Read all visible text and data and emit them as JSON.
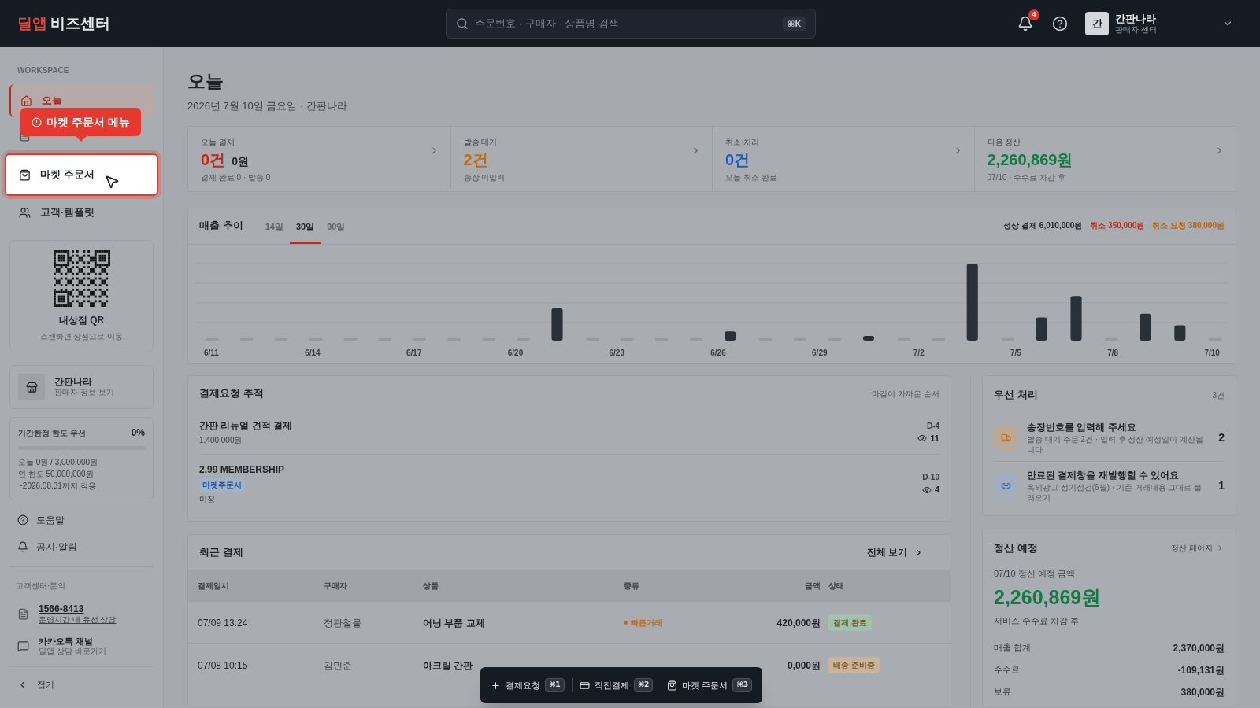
{
  "brand": {
    "accent": "딜앱",
    "name": "비즈센터"
  },
  "search": {
    "placeholder": "주문번호 · 구매자 · 상품명 검색",
    "shortcut": "⌘K"
  },
  "notifications": {
    "count": "4"
  },
  "account": {
    "avatar": "간",
    "name": "간판나라",
    "role": "판매자 센터"
  },
  "sidebar": {
    "section": "WORKSPACE",
    "items": [
      {
        "label": "오늘",
        "selected": true,
        "highlighted": false
      },
      {
        "label": "마켓 주문서",
        "selected": false,
        "highlighted": true
      },
      {
        "label": "고객·템플릿",
        "selected": false,
        "highlighted": false
      }
    ],
    "tooltip": "마켓 주문서 메뉴",
    "qr": {
      "title": "내상점 QR",
      "caption": "스캔하면 상점으로 이동"
    },
    "store": {
      "name": "간판나라",
      "link": "판매자 정보 보기"
    },
    "limit": {
      "title": "기간한정 한도 우선",
      "percent": "0%",
      "level": 0,
      "lines": [
        "오늘 0원 / 3,000,000원",
        "연 한도 50,000,000원",
        "~2026.08.31까지 적용"
      ]
    },
    "links": [
      "도움말",
      "공지·알림"
    ],
    "support_title": "고객센터·문의",
    "phone": {
      "number": "1566-8413",
      "note": "운영시간 내 유선 상담"
    },
    "kakao": {
      "title": "카카오톡 채널",
      "note": "딜앱 상담 바로가기"
    },
    "collapse": "접기"
  },
  "page": {
    "title": "오늘",
    "subtitle": "2026년 7월 10일 금요일 · 간판나라"
  },
  "metrics": [
    {
      "label": "오늘 결제",
      "value": "0건",
      "extra": "0원",
      "sub": "결제 완료 0 · 발송 0",
      "color": "#c4281c"
    },
    {
      "label": "발송 대기",
      "value": "2건",
      "sub": "송장 미입력",
      "color": "#c26a14"
    },
    {
      "label": "취소 처리",
      "value": "0건",
      "sub": "오늘 취소 완료",
      "color": "#1d5fbf"
    },
    {
      "label": "다음 정산",
      "value": "2,260,869원",
      "sub": "07/10 · 수수료 차감 후",
      "color": "#147a44"
    }
  ],
  "sales": {
    "title": "매출 추이",
    "tabs": [
      {
        "label": "14일",
        "selected": false
      },
      {
        "label": "30일",
        "selected": true
      },
      {
        "label": "90일",
        "selected": false
      }
    ],
    "legend": [
      {
        "label": "정상 결제 6,010,000원",
        "color": "#1f2329"
      },
      {
        "label": "취소 350,000원",
        "color": "#c4281c"
      },
      {
        "label": "취소 요청 380,000원",
        "color": "#b8660f"
      }
    ],
    "x_labels": [
      "6/11",
      "6/14",
      "6/17",
      "6/20",
      "6/23",
      "6/26",
      "6/29",
      "7/2",
      "7/5",
      "7/8",
      "7/10"
    ]
  },
  "tracking": {
    "title": "결제요청 추적",
    "order": "마감이 가까운 순서",
    "items": [
      {
        "title": "간판 리뉴얼 견적 결제",
        "amount": "1,400,000원",
        "dday": "D-4",
        "views": "11"
      },
      {
        "title": "2.99 MEMBERSHIP",
        "tag": "마켓주문서",
        "status": "미정",
        "dday": "D-10",
        "views": "4"
      }
    ]
  },
  "priority": {
    "title": "우선 처리",
    "count": "3건",
    "items": [
      {
        "kind": "shipping",
        "title": "송장번호를 입력해 주세요",
        "desc": "발송 대기 주문 2건 · 입력 후 정산 예정일이 계산됩니다",
        "count": "2"
      },
      {
        "kind": "link",
        "title": "만료된 결제창을 재발행할 수 있어요",
        "desc": "옥외광고 정기점검(6월) · 기존 거래내용 그대로 불러오기",
        "count": "1"
      }
    ]
  },
  "recent": {
    "title": "최근 결제",
    "view_all": "전체 보기",
    "columns": [
      "결제일시",
      "구매자",
      "상품",
      "종류",
      "금액",
      "상태"
    ],
    "rows": [
      {
        "date": "07/09 13:24",
        "buyer": "정관철물",
        "product": "어닝 부품 교체",
        "type": {
          "label": "빠른거래",
          "color": "#c26a14"
        },
        "amount": "420,000원",
        "status": {
          "label": "결제 완료",
          "color": "#9fc3ad"
        }
      },
      {
        "date": "07/08 10:15",
        "buyer": "김민준",
        "product": "아크릴 간판",
        "amount": "0,000원",
        "status": {
          "label": "배송 준비중",
          "color": "#c9b59a"
        }
      }
    ]
  },
  "settlement": {
    "title": "정산 예정",
    "link": "정산 페이지",
    "date_label": "07/10 정산 예정 금액",
    "amount": "2,260,869원",
    "note": "서비스 수수료 차감 후",
    "rows": [
      {
        "label": "매출 합계",
        "value": "2,370,000원"
      },
      {
        "label": "수수료",
        "value": "-109,131원"
      },
      {
        "label": "보류",
        "value": "380,000원"
      }
    ]
  },
  "toolbar": [
    {
      "label": "결제요청",
      "shortcut": "⌘1"
    },
    {
      "label": "직접결제",
      "shortcut": "⌘2"
    },
    {
      "label": "마켓 주문서",
      "shortcut": "⌘3"
    }
  ]
}
